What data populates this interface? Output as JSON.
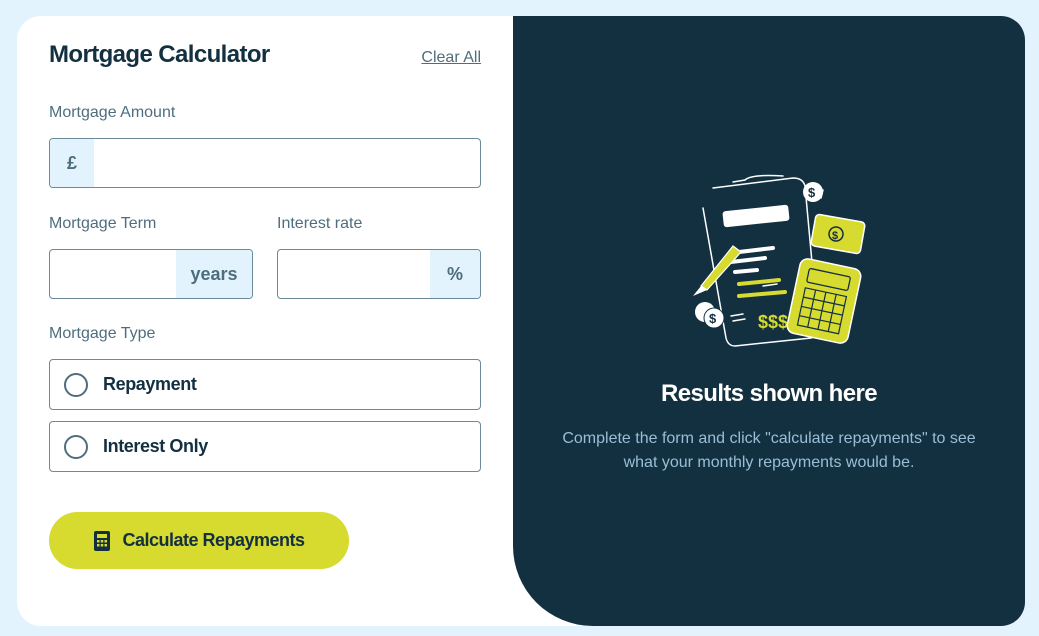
{
  "header": {
    "title": "Mortgage Calculator",
    "clear_label": "Clear All"
  },
  "form": {
    "amount": {
      "label": "Mortgage Amount",
      "prefix": "£",
      "value": ""
    },
    "term": {
      "label": "Mortgage Term",
      "suffix": "years",
      "value": ""
    },
    "rate": {
      "label": "Interest rate",
      "suffix": "%",
      "value": ""
    },
    "type": {
      "label": "Mortgage Type",
      "options": [
        {
          "label": "Repayment",
          "selected": false
        },
        {
          "label": "Interest Only",
          "selected": false
        }
      ]
    },
    "submit_label": "Calculate Repayments",
    "submit_icon": "calculator-icon"
  },
  "results": {
    "title": "Results shown here",
    "description": "Complete the form and click \"calculate repayments\" to see what your monthly repayments would be.",
    "illustration": "mortgage-documents-illustration"
  },
  "colors": {
    "background": "#e3f3fd",
    "dark": "#133041",
    "lime": "#d7da2f",
    "muted": "#4e6e7e",
    "addon_bg": "#e3f3fd"
  }
}
